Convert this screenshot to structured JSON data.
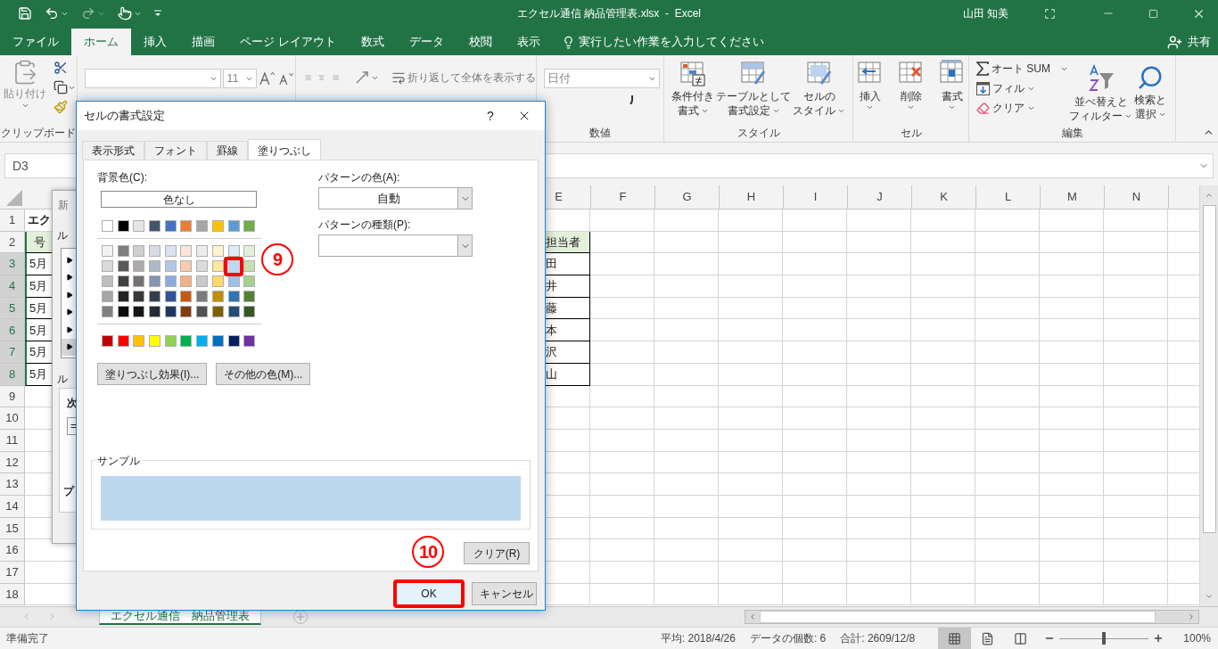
{
  "title_bar": {
    "title": "エクセル通信 納品管理表.xlsx  -  Excel",
    "user": "山田 知美"
  },
  "ribbon_tabs": [
    {
      "label": "ファイル",
      "selected": false
    },
    {
      "label": "ホーム",
      "selected": true
    },
    {
      "label": "挿入",
      "selected": false
    },
    {
      "label": "描画",
      "selected": false
    },
    {
      "label": "ページ レイアウト",
      "selected": false
    },
    {
      "label": "数式",
      "selected": false
    },
    {
      "label": "データ",
      "selected": false
    },
    {
      "label": "校閲",
      "selected": false
    },
    {
      "label": "表示",
      "selected": false
    }
  ],
  "tell_me": "実行したい作業を入力してください",
  "share": "共有",
  "ribbon": {
    "clipboard": {
      "paste": "貼り付け",
      "label": "クリップボード"
    },
    "font": {
      "size": "11"
    },
    "alignment": {
      "wrap_text": "折り返して全体を表示する"
    },
    "number": {
      "format": "日付",
      "label": "数値"
    },
    "styles": {
      "buttons": [
        [
          "条件付き",
          "書式"
        ],
        [
          "テーブルとして",
          "書式設定"
        ],
        [
          "セルの",
          "スタイル"
        ]
      ],
      "label": "スタイル"
    },
    "cells": {
      "buttons": [
        "挿入",
        "削除",
        "書式"
      ],
      "label": "セル"
    },
    "editing": {
      "autosum": "オート SUM",
      "fill": "フィル",
      "clear": "クリア",
      "sort": [
        "並べ替えと",
        "フィルター"
      ],
      "find": [
        "検索と",
        "選択"
      ],
      "label": "編集"
    }
  },
  "name_box": "D3",
  "sheet": {
    "columns": [
      "E",
      "F",
      "G",
      "H",
      "I",
      "J",
      "K",
      "L",
      "M",
      "N"
    ],
    "rows": [
      {
        "number": "1",
        "selected": false,
        "kind": "title",
        "a": "エク"
      },
      {
        "number": "2",
        "selected": false,
        "kind": "header",
        "a": "号",
        "e": "担当者"
      },
      {
        "number": "3",
        "selected": true,
        "kind": "data",
        "a": "5月",
        "e": "田"
      },
      {
        "number": "4",
        "selected": true,
        "kind": "data",
        "a": "5月",
        "e": "井"
      },
      {
        "number": "5",
        "selected": true,
        "kind": "data",
        "a": "5月",
        "e": "藤"
      },
      {
        "number": "6",
        "selected": true,
        "kind": "data",
        "a": "5月",
        "e": "本"
      },
      {
        "number": "7",
        "selected": true,
        "kind": "data",
        "a": "5月",
        "e": "沢"
      },
      {
        "number": "8",
        "selected": true,
        "kind": "data",
        "a": "5月",
        "e": "山"
      },
      {
        "number": "9",
        "selected": false,
        "kind": "empty"
      },
      {
        "number": "10",
        "selected": false,
        "kind": "empty"
      },
      {
        "number": "11",
        "selected": false,
        "kind": "empty"
      },
      {
        "number": "12",
        "selected": false,
        "kind": "empty"
      },
      {
        "number": "13",
        "selected": false,
        "kind": "empty"
      },
      {
        "number": "14",
        "selected": false,
        "kind": "empty"
      },
      {
        "number": "15",
        "selected": false,
        "kind": "empty"
      },
      {
        "number": "16",
        "selected": false,
        "kind": "empty"
      },
      {
        "number": "17",
        "selected": false,
        "kind": "empty"
      },
      {
        "number": "18",
        "selected": false,
        "kind": "empty"
      }
    ]
  },
  "background_dialog": {
    "title": "新",
    "section_1": "ル",
    "rule_items": [
      {
        "selected": false
      },
      {
        "selected": false
      },
      {
        "selected": false
      },
      {
        "selected": false
      },
      {
        "selected": false
      },
      {
        "selected": true
      }
    ],
    "section_2": "ル",
    "edit_heading": "次",
    "formula": "=",
    "preview": "プ"
  },
  "dialog": {
    "title": "セルの書式設定",
    "help": "?",
    "tabs": [
      {
        "label": "表示形式",
        "selected": false
      },
      {
        "label": "フォント",
        "selected": false
      },
      {
        "label": "罫線",
        "selected": false
      },
      {
        "label": "塗りつぶし",
        "selected": true
      }
    ],
    "background_label": "背景色(C):",
    "no_color": "色なし",
    "theme_colors": [
      {
        "color": "#ffffff",
        "selected": false
      },
      {
        "color": "#000000",
        "selected": false
      },
      {
        "color": "#e7e6e6",
        "selected": false
      },
      {
        "color": "#44546a",
        "selected": false
      },
      {
        "color": "#4472c4",
        "selected": false
      },
      {
        "color": "#ed7d31",
        "selected": false
      },
      {
        "color": "#a5a5a5",
        "selected": false
      },
      {
        "color": "#ffc000",
        "selected": false
      },
      {
        "color": "#5b9bd5",
        "selected": false
      },
      {
        "color": "#70ad47",
        "selected": false
      }
    ],
    "tint_rows": [
      [
        {
          "color": "#f2f2f2",
          "selected": false
        },
        {
          "color": "#7f7f7f",
          "selected": false
        },
        {
          "color": "#d0cece",
          "selected": false
        },
        {
          "color": "#d6dce4",
          "selected": false
        },
        {
          "color": "#d9e1f2",
          "selected": false
        },
        {
          "color": "#fce4d6",
          "selected": false
        },
        {
          "color": "#ededed",
          "selected": false
        },
        {
          "color": "#fff2cc",
          "selected": false
        },
        {
          "color": "#ddebf7",
          "selected": false
        },
        {
          "color": "#e2efda",
          "selected": false
        }
      ],
      [
        {
          "color": "#d9d9d9",
          "selected": false
        },
        {
          "color": "#595959",
          "selected": false
        },
        {
          "color": "#aeaaaa",
          "selected": false
        },
        {
          "color": "#acb9ca",
          "selected": false
        },
        {
          "color": "#b4c6e7",
          "selected": false
        },
        {
          "color": "#f8cbad",
          "selected": false
        },
        {
          "color": "#dbdbdb",
          "selected": false
        },
        {
          "color": "#ffe699",
          "selected": false
        },
        {
          "color": "#bdd7ee",
          "selected": true
        },
        {
          "color": "#c6e0b4",
          "selected": false
        }
      ],
      [
        {
          "color": "#bfbfbf",
          "selected": false
        },
        {
          "color": "#404040",
          "selected": false
        },
        {
          "color": "#757171",
          "selected": false
        },
        {
          "color": "#8496b0",
          "selected": false
        },
        {
          "color": "#8ea9db",
          "selected": false
        },
        {
          "color": "#f4b084",
          "selected": false
        },
        {
          "color": "#c9c9c9",
          "selected": false
        },
        {
          "color": "#ffd966",
          "selected": false
        },
        {
          "color": "#9bc2e6",
          "selected": false
        },
        {
          "color": "#a9d08e",
          "selected": false
        }
      ],
      [
        {
          "color": "#a6a6a6",
          "selected": false
        },
        {
          "color": "#262626",
          "selected": false
        },
        {
          "color": "#3a3838",
          "selected": false
        },
        {
          "color": "#333f4f",
          "selected": false
        },
        {
          "color": "#305496",
          "selected": false
        },
        {
          "color": "#c65911",
          "selected": false
        },
        {
          "color": "#7b7b7b",
          "selected": false
        },
        {
          "color": "#bf8f00",
          "selected": false
        },
        {
          "color": "#2f75b5",
          "selected": false
        },
        {
          "color": "#548235",
          "selected": false
        }
      ],
      [
        {
          "color": "#808080",
          "selected": false
        },
        {
          "color": "#0d0d0d",
          "selected": false
        },
        {
          "color": "#171616",
          "selected": false
        },
        {
          "color": "#222a35",
          "selected": false
        },
        {
          "color": "#203764",
          "selected": false
        },
        {
          "color": "#833c0c",
          "selected": false
        },
        {
          "color": "#525252",
          "selected": false
        },
        {
          "color": "#806000",
          "selected": false
        },
        {
          "color": "#1f4e78",
          "selected": false
        },
        {
          "color": "#375623",
          "selected": false
        }
      ]
    ],
    "standard_colors": [
      {
        "color": "#c00000",
        "selected": false
      },
      {
        "color": "#ff0000",
        "selected": false
      },
      {
        "color": "#ffc000",
        "selected": false
      },
      {
        "color": "#ffff00",
        "selected": false
      },
      {
        "color": "#92d050",
        "selected": false
      },
      {
        "color": "#00b050",
        "selected": false
      },
      {
        "color": "#00b0f0",
        "selected": false
      },
      {
        "color": "#0070c0",
        "selected": false
      },
      {
        "color": "#002060",
        "selected": false
      },
      {
        "color": "#7030a0",
        "selected": false
      }
    ],
    "fill_effects": "塗りつぶし効果(I)...",
    "more_colors": "その他の色(M)...",
    "pattern_color_label": "パターンの色(A):",
    "pattern_color": "自動",
    "pattern_style_label": "パターンの種類(P):",
    "sample_label": "サンプル",
    "clear": "クリア(R)",
    "ok": {
      "label": "OK",
      "highlighted": true
    },
    "cancel": "キャンセル",
    "callouts": [
      "9",
      "10"
    ]
  },
  "sheet_tabs": [
    {
      "label": "エクセル通信　納品管理表",
      "selected": true
    }
  ],
  "status_bar": {
    "ready": "準備完了",
    "average": "平均: 2018/4/26",
    "count": "データの個数: 6",
    "sum": "合計: 2609/12/8",
    "views": [
      {
        "selected": true
      },
      {
        "selected": false
      },
      {
        "selected": false
      }
    ],
    "zoom": {
      "level": 0.5,
      "reading": "100%"
    }
  }
}
